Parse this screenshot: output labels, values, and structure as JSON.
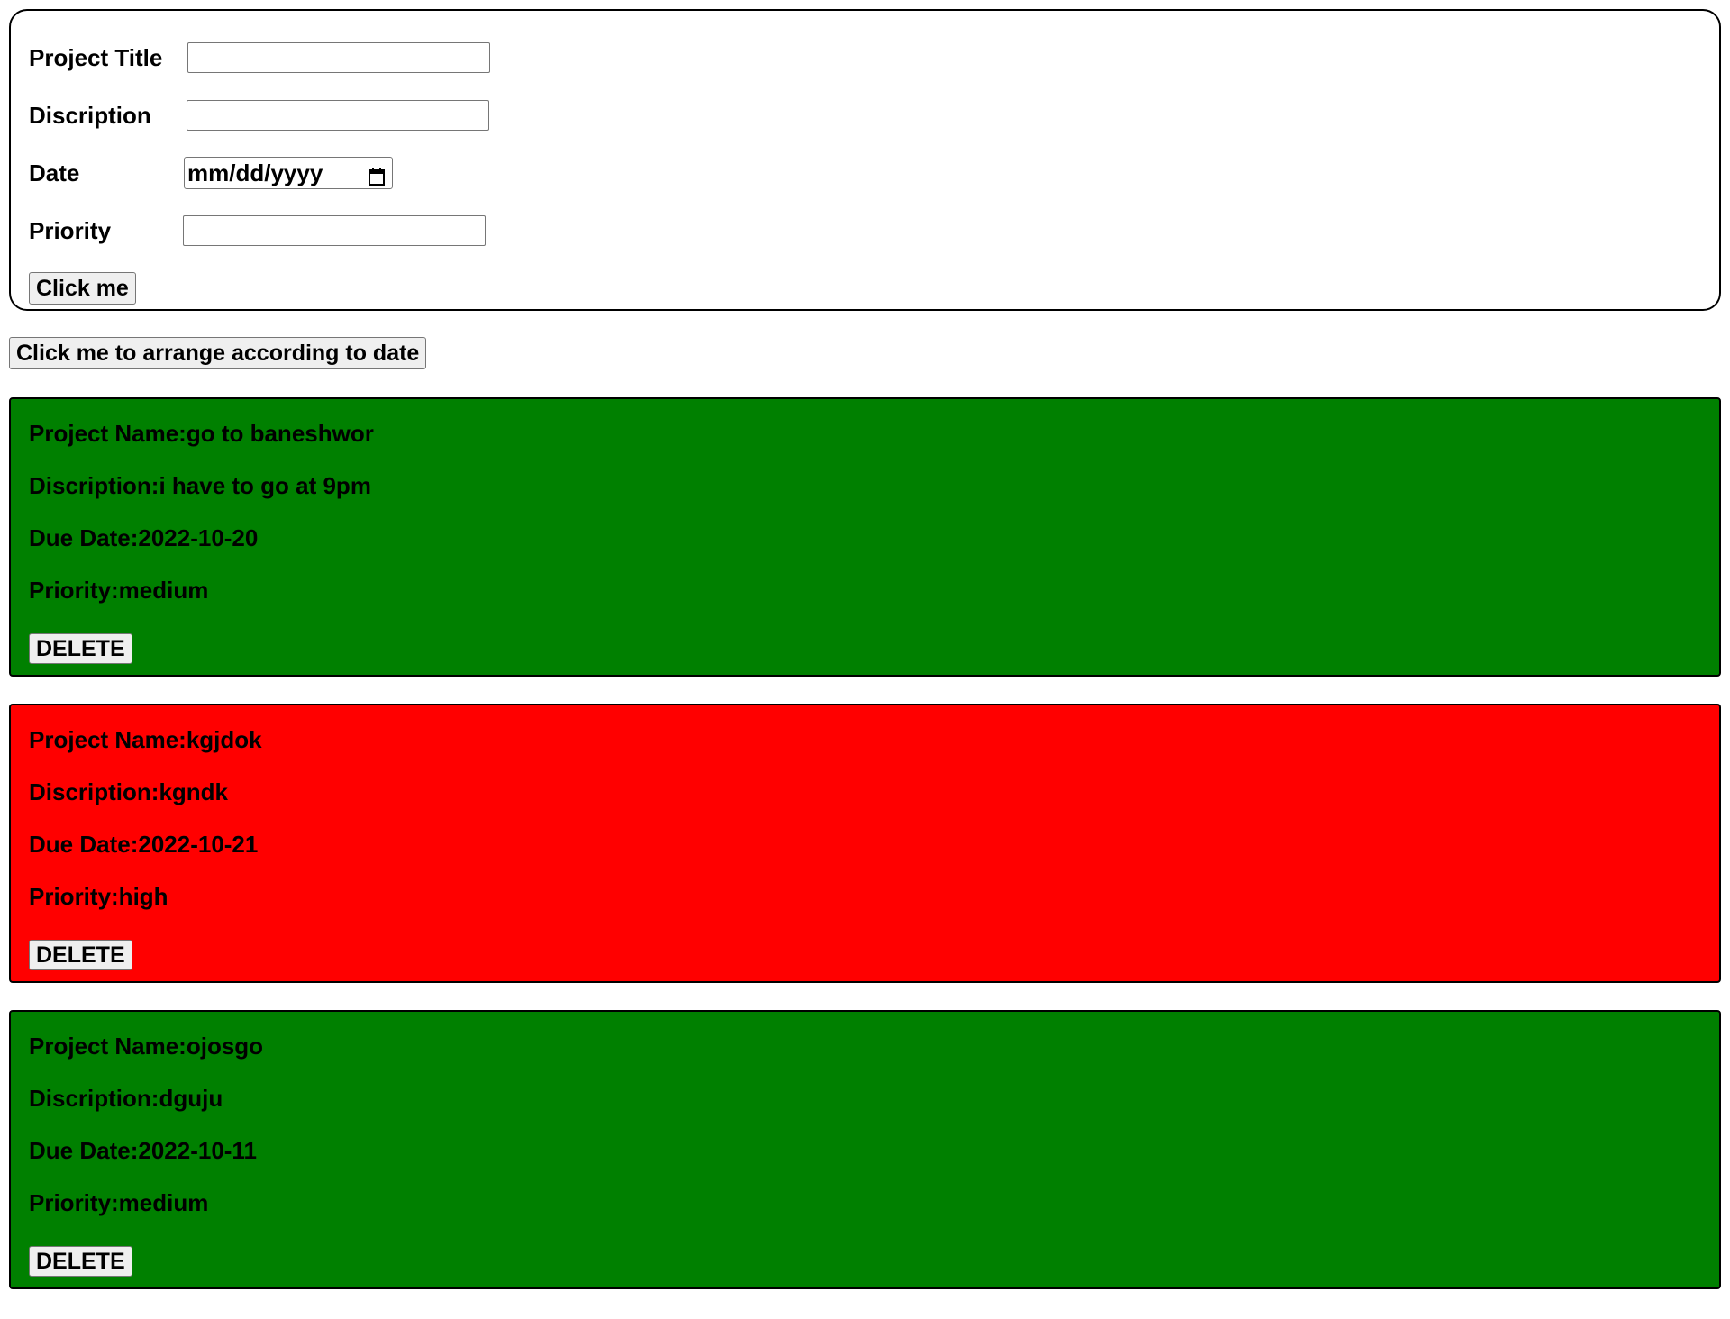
{
  "form": {
    "title_label": "Project Title",
    "title_value": "",
    "description_label": "Discription",
    "description_value": "",
    "date_label": "Date",
    "date_placeholder": "mm/dd/yyyy",
    "priority_label": "Priority",
    "priority_value": "",
    "submit_label": "Click me"
  },
  "arrange_button_label": "Click me to arrange according to date",
  "colors": {
    "medium": "#008000",
    "high": "#ff0000"
  },
  "projects": [
    {
      "name": "Project Name:go to baneshwor",
      "description": "Discription:i have to go at 9pm",
      "due_date": "Due Date:2022-10-20",
      "priority": "Priority:medium",
      "delete_label": "DELETE",
      "color": "#008000"
    },
    {
      "name": "Project Name:kgjdok",
      "description": "Discription:kgndk",
      "due_date": "Due Date:2022-10-21",
      "priority": "Priority:high",
      "delete_label": "DELETE",
      "color": "#ff0000"
    },
    {
      "name": "Project Name:ojosgo",
      "description": "Discription:dguju",
      "due_date": "Due Date:2022-10-11",
      "priority": "Priority:medium",
      "delete_label": "DELETE",
      "color": "#008000"
    }
  ]
}
